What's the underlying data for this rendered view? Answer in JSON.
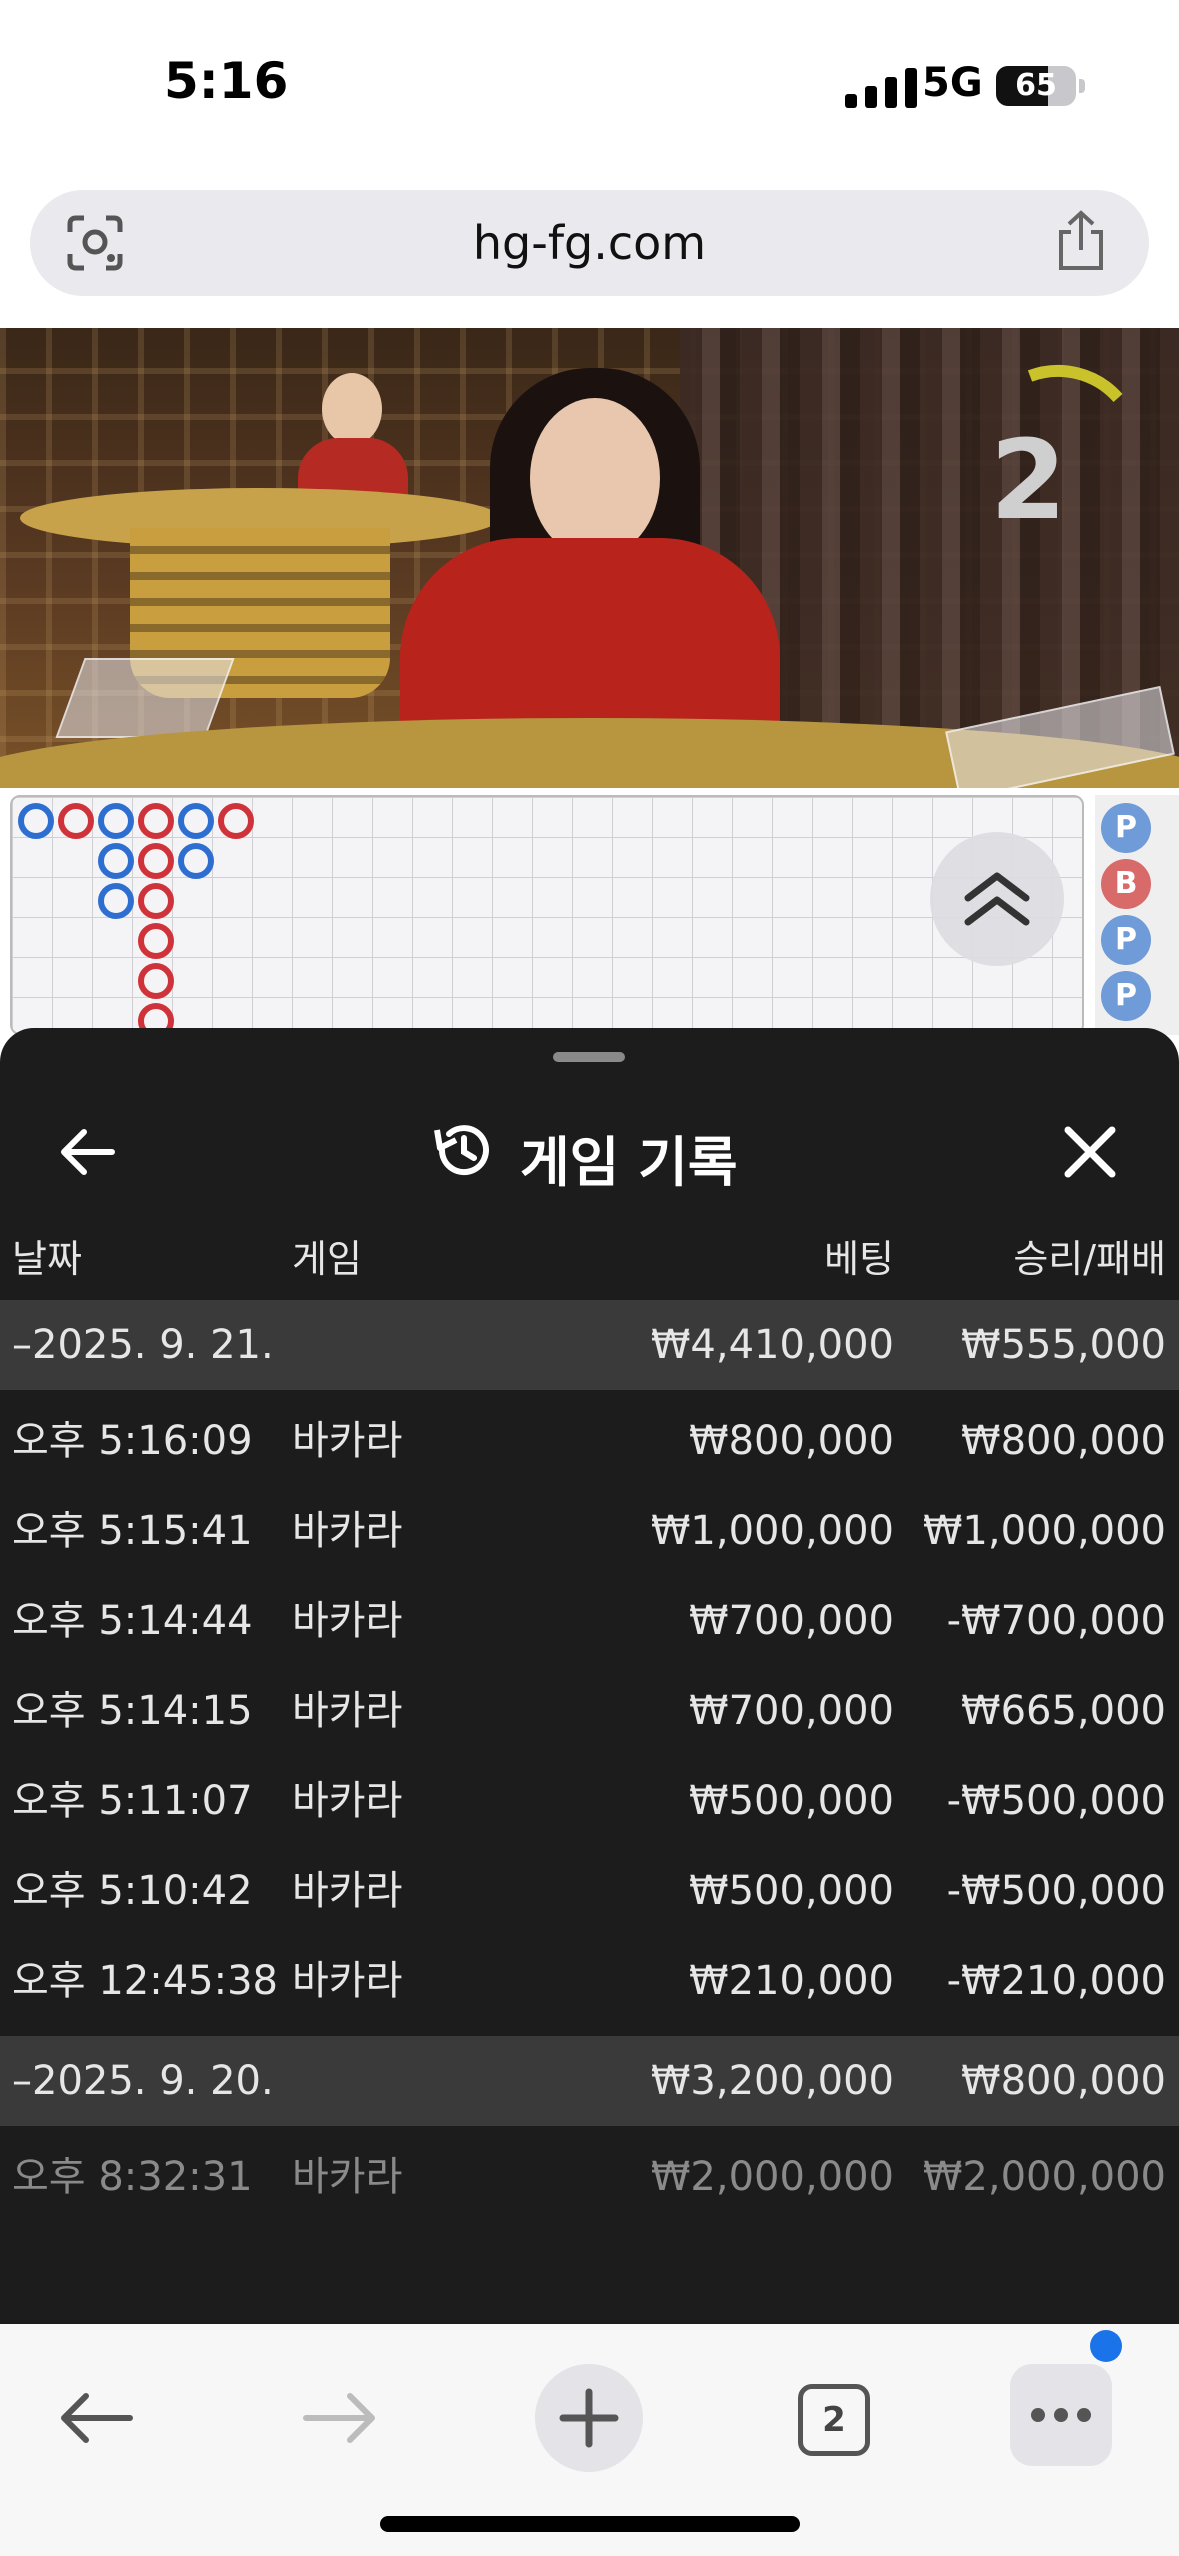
{
  "status_bar": {
    "time": "5:16",
    "network": "5G",
    "battery": "65",
    "battery_level": 0.65
  },
  "browser": {
    "url": "hg-fg.com"
  },
  "video": {
    "countdown": "2"
  },
  "road_map": {
    "side_beads": [
      "P",
      "B",
      "P",
      "P"
    ]
  },
  "history": {
    "title": "게임 기록",
    "columns": {
      "date": "날짜",
      "game": "게임",
      "bet": "베팅",
      "win_loss": "승리/패배"
    },
    "groups": [
      {
        "date": "–2025. 9. 21.",
        "bet_total": "₩4,410,000",
        "win_total": "₩555,000",
        "rows": [
          {
            "time": "오후 5:16:09",
            "game": "바카라",
            "bet": "₩800,000",
            "result": "₩800,000"
          },
          {
            "time": "오후 5:15:41",
            "game": "바카라",
            "bet": "₩1,000,000",
            "result": "₩1,000,000"
          },
          {
            "time": "오후 5:14:44",
            "game": "바카라",
            "bet": "₩700,000",
            "result": "-₩700,000"
          },
          {
            "time": "오후 5:14:15",
            "game": "바카라",
            "bet": "₩700,000",
            "result": "₩665,000"
          },
          {
            "time": "오후 5:11:07",
            "game": "바카라",
            "bet": "₩500,000",
            "result": "-₩500,000"
          },
          {
            "time": "오후 5:10:42",
            "game": "바카라",
            "bet": "₩500,000",
            "result": "-₩500,000"
          },
          {
            "time": "오후 12:45:38",
            "game": "바카라",
            "bet": "₩210,000",
            "result": "-₩210,000"
          }
        ]
      },
      {
        "date": "–2025. 9. 20.",
        "bet_total": "₩3,200,000",
        "win_total": "₩800,000",
        "rows": [
          {
            "time": "오후 8:32:31",
            "game": "바카라",
            "bet": "₩2,000,000",
            "result": "₩2,000,000"
          }
        ]
      }
    ]
  },
  "toolbar": {
    "tab_count": "2"
  },
  "colors": {
    "accent_blue": "#1a73e8",
    "banker_red": "#d0323a",
    "player_blue": "#2f6ed1",
    "sheet_bg": "#1c1c1c"
  }
}
